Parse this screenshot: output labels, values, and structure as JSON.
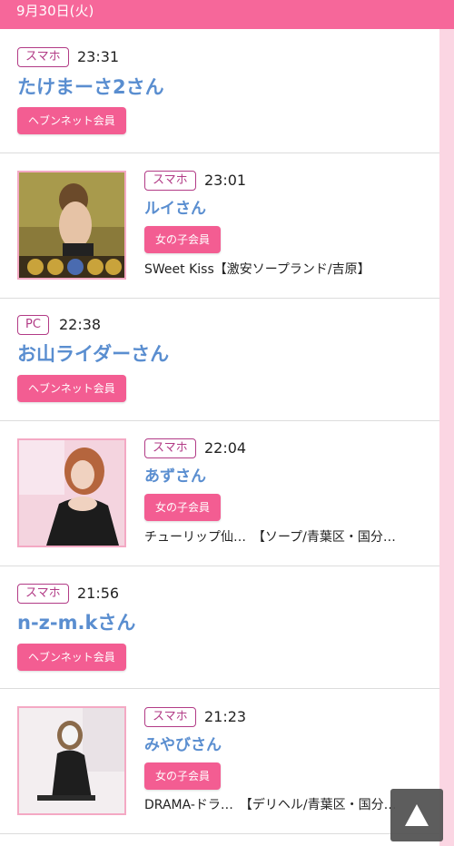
{
  "date_header": "9月30日(火)",
  "entries": [
    {
      "device": "スマホ",
      "time": "23:31",
      "name": "たけまーさ2さん",
      "member_type": "ヘブンネット会員",
      "shop": ""
    },
    {
      "device": "スマホ",
      "time": "23:01",
      "name": "ルイさん",
      "member_type": "女の子会員",
      "shop": "SWeet Kiss【激安ソープランド/吉原】"
    },
    {
      "device": "PC",
      "time": "22:38",
      "name": "お山ライダーさん",
      "member_type": "ヘブンネット会員",
      "shop": ""
    },
    {
      "device": "スマホ",
      "time": "22:04",
      "name": "あずさん",
      "member_type": "女の子会員",
      "shop": "チューリップ仙…　【ソープ/青葉区・国分…"
    },
    {
      "device": "スマホ",
      "time": "21:56",
      "name": "n-z-m.kさん",
      "member_type": "ヘブンネット会員",
      "shop": ""
    },
    {
      "device": "スマホ",
      "time": "21:23",
      "name": "みやびさん",
      "member_type": "女の子会員",
      "shop": "DRAMA-ドラ…　【デリヘル/青葉区・国分…"
    }
  ],
  "icons": {
    "scroll_top": "triangle-up-icon"
  },
  "colors": {
    "header_pink": "#f6679a",
    "badge_purple": "#b23b86",
    "name_blue": "#5a8ed0",
    "button_pink": "#f35d92"
  }
}
